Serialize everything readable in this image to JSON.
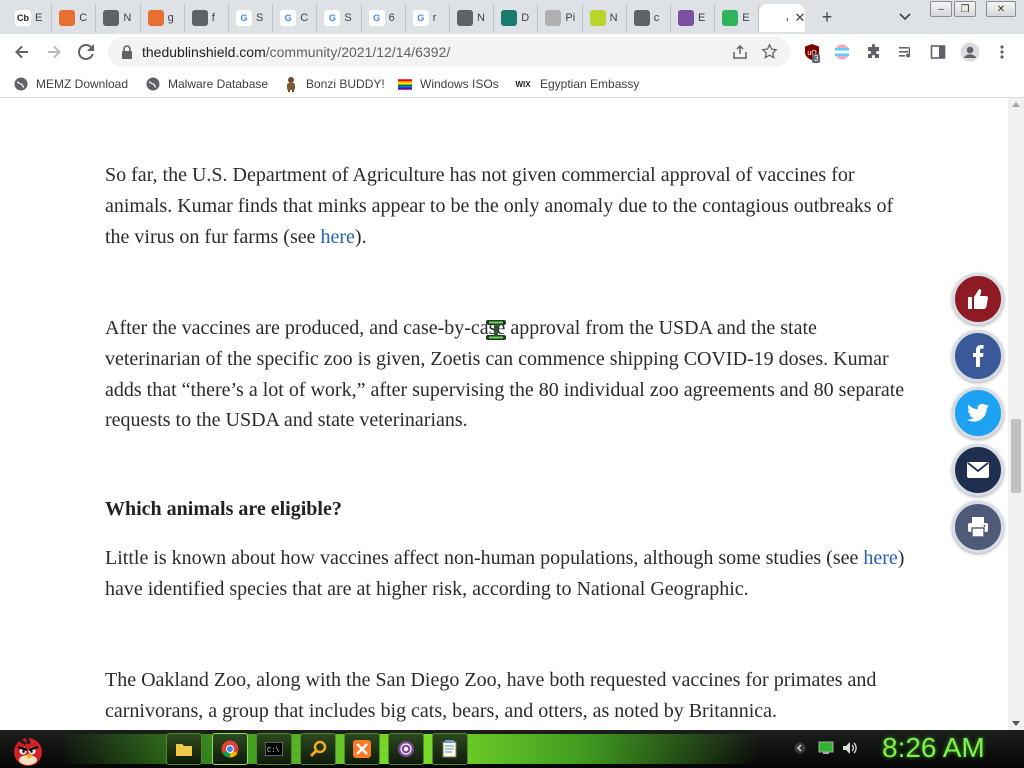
{
  "browser": {
    "tabs": [
      {
        "badge": "Cb",
        "badge_color": "#ffffff",
        "badge_text_color": "#222222",
        "title": "E"
      },
      {
        "badge": "",
        "badge_color": "#e96f31",
        "title": "C"
      },
      {
        "badge": "",
        "badge_color": "#5f6368",
        "title": "N"
      },
      {
        "badge": "",
        "badge_color": "#e96f31",
        "title": "g"
      },
      {
        "badge": "",
        "badge_color": "#5f6368",
        "title": "f"
      },
      {
        "badge": "G",
        "badge_color": "#ffffff",
        "badge_text_color": "#4285f4",
        "title": "S"
      },
      {
        "badge": "G",
        "badge_color": "#ffffff",
        "badge_text_color": "#4285f4",
        "title": "C"
      },
      {
        "badge": "G",
        "badge_color": "#ffffff",
        "badge_text_color": "#4285f4",
        "title": "S"
      },
      {
        "badge": "G",
        "badge_color": "#ffffff",
        "badge_text_color": "#4285f4",
        "title": "6"
      },
      {
        "badge": "G",
        "badge_color": "#ffffff",
        "badge_text_color": "#4285f4",
        "title": "r"
      },
      {
        "badge": "",
        "badge_color": "#5f6368",
        "title": "N"
      },
      {
        "badge": "",
        "badge_color": "#1a7a6e",
        "title": "D"
      },
      {
        "badge": "",
        "badge_color": "#b0b0b0",
        "title": "Pi"
      },
      {
        "badge": "",
        "badge_color": "#b9d62a",
        "title": "N"
      },
      {
        "badge": "",
        "badge_color": "#5f6368",
        "title": "c"
      },
      {
        "badge": "",
        "badge_color": "#7b4fa3",
        "title": "E"
      },
      {
        "badge": "",
        "badge_color": "#2fb35b",
        "title": "E"
      },
      {
        "badge": "",
        "badge_color": "#ffffff",
        "title": "A",
        "active": true
      }
    ],
    "new_tab_label": "+",
    "address": {
      "domain": "thedublinshield.com",
      "path": "/community/2021/12/14/6392/"
    },
    "extension_badge": "3",
    "bookmarks": [
      {
        "label": "MEMZ Download",
        "icon": "globe-icon"
      },
      {
        "label": "Malware Database",
        "icon": "globe-icon"
      },
      {
        "label": "Bonzi BUDDY!",
        "icon": "bonzi-icon"
      },
      {
        "label": "Windows ISOs",
        "icon": "rainbow-flag-icon"
      },
      {
        "label": "Egyptian Embassy",
        "icon": "wix-icon",
        "icon_text": "WIX"
      }
    ]
  },
  "article": {
    "p1": {
      "text": "So far, the U.S. Department of Agriculture has not given commercial approval of vaccines for animals. Kumar finds that minks appear to be the only anomaly due to the contagious outbreaks of the virus on fur farms (see ",
      "link": "here",
      "after": ")."
    },
    "p2": "After the vaccines are produced, and case-by-case approval from the USDA and the state veterinarian of the specific zoo is given, Zoetis can commence shipping COVID-19 doses. Kumar adds that “there’s a lot of work,” after supervising the 80 individual zoo agreements and 80 separate requests to the USDA and state veterinarians.",
    "heading": "Which animals are eligible?",
    "p3": {
      "text": "Little is known about how vaccines affect non-human populations, although some studies (see ",
      "link": "here",
      "after": ") have identified species that are at higher risk, according to National Geographic."
    },
    "p4": "The Oakland Zoo, along with the San Diego Zoo, have both requested vaccines for primates and carnivorans, a group that includes big cats, bears, and otters, as noted by Britannica."
  },
  "share_buttons": [
    {
      "name": "like-button",
      "icon": "thumbs-up-icon",
      "color": "#8e1b24"
    },
    {
      "name": "facebook-share-button",
      "icon": "facebook-icon",
      "color": "#3b5998"
    },
    {
      "name": "twitter-share-button",
      "icon": "twitter-icon",
      "color": "#1da1f2"
    },
    {
      "name": "email-share-button",
      "icon": "email-icon",
      "color": "#1f2f4f"
    },
    {
      "name": "print-button",
      "icon": "print-icon",
      "color": "#4e5a77"
    }
  ],
  "scroll_position": 0.58,
  "taskbar": {
    "clock": "8:26 AM",
    "accent": "#7df24a"
  }
}
